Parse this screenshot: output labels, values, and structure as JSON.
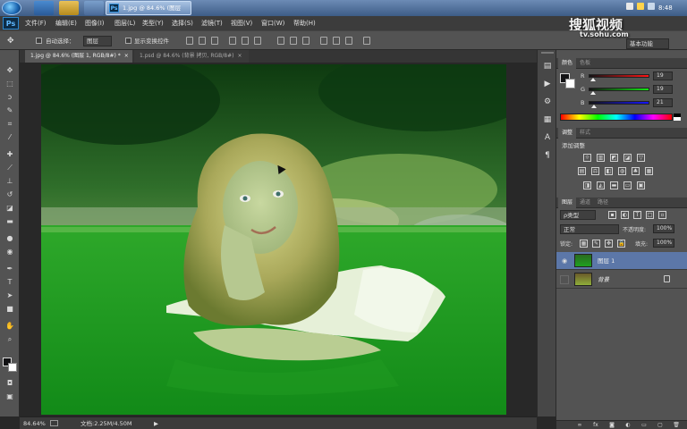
{
  "taskbar": {
    "active_task": "1.jpg @ 84.6% (图层",
    "ps_mini": "Ps",
    "clock": "8:48"
  },
  "menubar": {
    "logo": "Ps",
    "items": [
      "文件(F)",
      "编辑(E)",
      "图像(I)",
      "图层(L)",
      "类型(Y)",
      "选择(S)",
      "滤镜(T)",
      "视图(V)",
      "窗口(W)",
      "帮助(H)"
    ]
  },
  "watermark": {
    "brand": "搜狐视频",
    "url": "tv.sohu.com"
  },
  "options": {
    "auto_select_label": "自动选择：",
    "auto_select_value": "图层",
    "show_transform_label": "显示变换控件",
    "workspace_value": "基本功能"
  },
  "tabs": [
    {
      "label": "1.jpg @ 84.6% (图层 1, RGB/8#) *",
      "close": "×",
      "active": true
    },
    {
      "label": "1.psd @ 84.6% (背景 拷贝, RGB/8#)",
      "close": "×",
      "active": false
    }
  ],
  "status": {
    "zoom": "84.64%",
    "doc": "文档:2.25M/4.50M",
    "arrow": "▶"
  },
  "color_panel": {
    "tabs": [
      "颜色",
      "色板"
    ],
    "r_label": "R",
    "g_label": "G",
    "b_label": "B",
    "r_value": "19",
    "g_value": "19",
    "b_value": "21",
    "r_level": 0.075,
    "g_level": 0.075,
    "b_level": 0.082
  },
  "adjust_panel": {
    "tabs": [
      "调整",
      "样式"
    ],
    "title": "添加调整"
  },
  "layers_panel": {
    "tabs": [
      "图层",
      "通道",
      "路径"
    ],
    "kind_label": "ρ类型",
    "blend_mode": "正常",
    "opacity_label": "不透明度:",
    "opacity_value": "100%",
    "lock_label": "锁定:",
    "fill_label": "填充:",
    "fill_value": "100%",
    "layers": [
      {
        "name": "图层 1",
        "visible": true,
        "selected": true
      },
      {
        "name": "背景",
        "visible": false,
        "selected": false
      }
    ]
  },
  "colors": {
    "accent_selected_layer": "#5c77a8",
    "panel_bg": "#535353",
    "canvas_bg": "#282828"
  }
}
